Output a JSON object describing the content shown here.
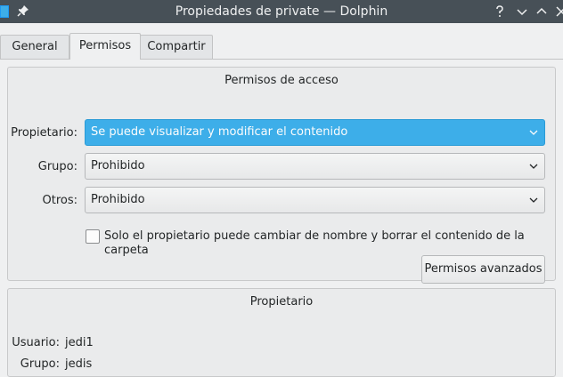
{
  "window": {
    "title": "Propiedades de private — Dolphin"
  },
  "tabs": [
    {
      "label": "General"
    },
    {
      "label": "Permisos"
    },
    {
      "label": "Compartir"
    }
  ],
  "access": {
    "title": "Permisos de acceso",
    "owner_label": "Propietario:",
    "owner_value": "Se puede visualizar y modificar el contenido",
    "group_label": "Grupo:",
    "group_value": "Prohibido",
    "others_label": "Otros:",
    "others_value": "Prohibido",
    "checkbox_label": "Solo el propietario puede cambiar de nombre y borrar el contenido de la carpeta",
    "checkbox_checked": false,
    "advanced_button": "Permisos avanzados"
  },
  "ownership": {
    "title": "Propietario",
    "user_label": "Usuario:",
    "user_value": "jedi1",
    "group_label": "Grupo:",
    "group_value": "jedis"
  },
  "colors": {
    "accent": "#3daee9",
    "titlebar": "#475057"
  }
}
